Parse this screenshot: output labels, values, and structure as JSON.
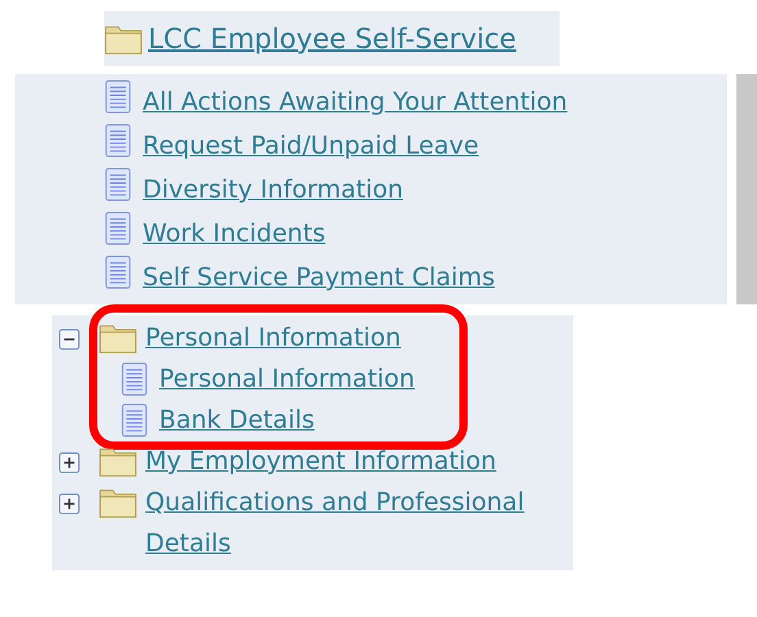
{
  "header": {
    "label": "LCC Employee Self-Service"
  },
  "actions": [
    {
      "label": "All Actions Awaiting Your Attention"
    },
    {
      "label": "Request Paid/Unpaid Leave"
    },
    {
      "label": "Diversity Information"
    },
    {
      "label": "Work Incidents"
    },
    {
      "label": "Self Service Payment Claims"
    }
  ],
  "tree": [
    {
      "label": "Personal Information",
      "expanded": true,
      "highlighted": true,
      "children": [
        {
          "label": "Personal Information"
        },
        {
          "label": "Bank Details"
        }
      ]
    },
    {
      "label": "My Employment Information",
      "expanded": false,
      "highlighted": false
    },
    {
      "label": "Qualifications and Professional Details",
      "expanded": false,
      "highlighted": false
    }
  ]
}
